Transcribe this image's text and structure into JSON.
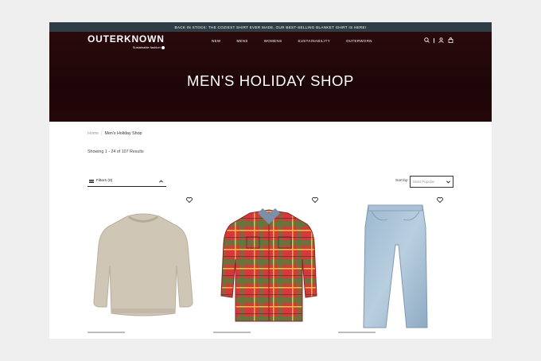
{
  "announcement": "BACK IN STOCK: THE COZIEST SHIRT EVER MADE, OUR BEST-SELLING BLANKET SHIRT IS HERE!",
  "brand": {
    "name": "OUTERKNOWN",
    "tagline": "Sustainable fashion"
  },
  "nav": {
    "items": [
      "NEW",
      "MENS",
      "WOMENS",
      "SUSTAINABILITY",
      "OUTERWORN"
    ]
  },
  "hero": {
    "title": "MEN'S HOLIDAY SHOP"
  },
  "breadcrumb": {
    "home": "Home",
    "separator": "|",
    "current": "Men's Holiday Shop"
  },
  "results": {
    "text": "Showing 1 - 24 of 107 Results"
  },
  "filters": {
    "label": "Filters (0)"
  },
  "sort": {
    "label": "Sort by:",
    "selected": "Most Popular"
  },
  "products": [
    {
      "name": "sweater",
      "icon": "heart-icon"
    },
    {
      "name": "plaid-shirt",
      "icon": "heart-icon"
    },
    {
      "name": "jeans",
      "icon": "heart-icon"
    }
  ],
  "colors": {
    "hero_bg": "#240709",
    "announce_bg": "#2f3d44"
  }
}
